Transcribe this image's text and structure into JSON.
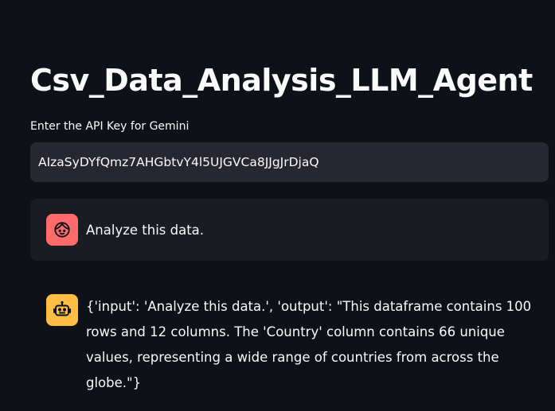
{
  "page": {
    "title": "Csv_Data_Analysis_LLM_Agent"
  },
  "api_key_field": {
    "label": "Enter the API Key for Gemini",
    "value": "AIzaSyDYfQmz7AHGbtvY4l5UJGVCa8JJgJrDjaQ"
  },
  "chat": {
    "user_message": {
      "avatar_icon": "user-face-icon",
      "avatar_color": "#ff6b6b",
      "text": "Analyze this data."
    },
    "assistant_message": {
      "avatar_icon": "robot-icon",
      "avatar_color": "#ffbd45",
      "text": "{'input': 'Analyze this data.', 'output': \"This dataframe contains 100 rows and 12 columns. The 'Country' column contains 66 unique values, representing a wide range of countries from across the globe.\"}"
    }
  },
  "colors": {
    "background": "#0e1117",
    "input_background": "#262730",
    "user_message_background": "#1a1c24",
    "text": "#fafafa"
  }
}
